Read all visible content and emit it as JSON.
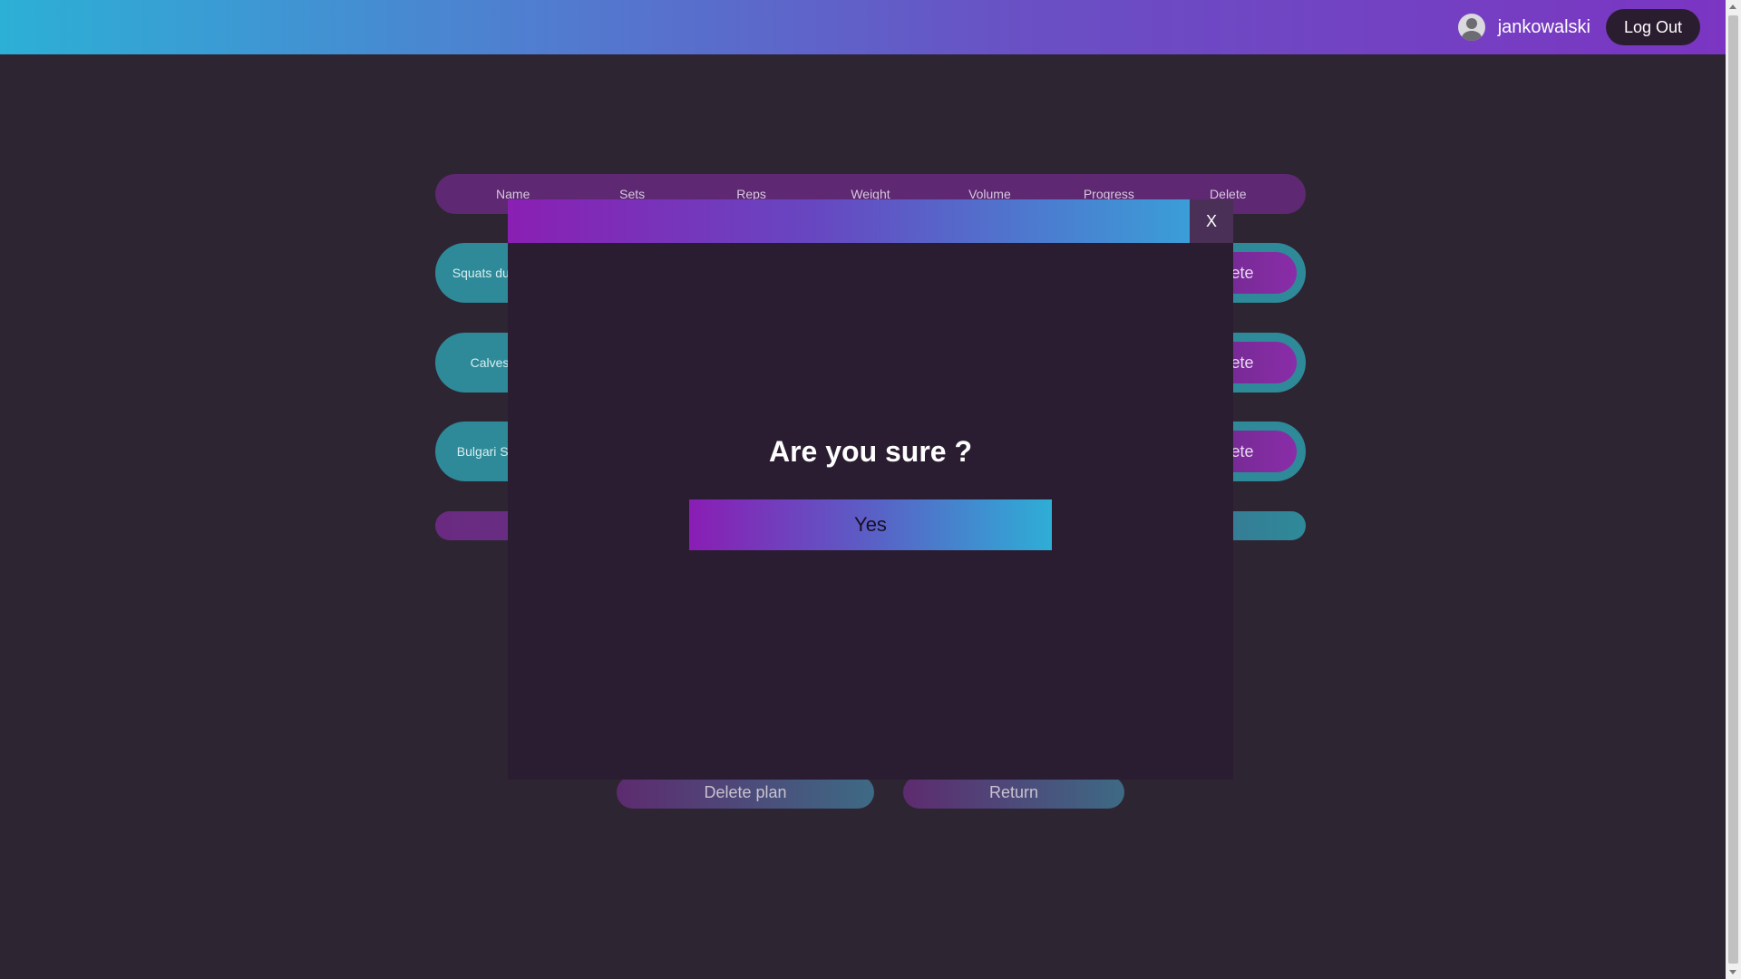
{
  "header": {
    "username": "jankowalski",
    "logout_label": "Log Out"
  },
  "table": {
    "columns": [
      "Name",
      "Sets",
      "Reps",
      "Weight",
      "Volume",
      "Progress",
      "Delete"
    ],
    "rows": [
      {
        "name": "Squats dumb",
        "delete_label": "ete"
      },
      {
        "name": "Calves",
        "delete_label": "ete"
      },
      {
        "name": "Bulgari Squ",
        "delete_label": "ete"
      }
    ]
  },
  "actions": {
    "delete_plan_label": "Delete plan",
    "return_label": "Return"
  },
  "modal": {
    "close_label": "X",
    "title": "Are you sure ?",
    "yes_label": "Yes"
  },
  "colors": {
    "page_bg": "#2e2533",
    "modal_bg": "#2b1d31",
    "row_teal": "#2e8a98",
    "accent_purple": "#8a1fb4",
    "accent_cyan": "#2cb0d6"
  }
}
